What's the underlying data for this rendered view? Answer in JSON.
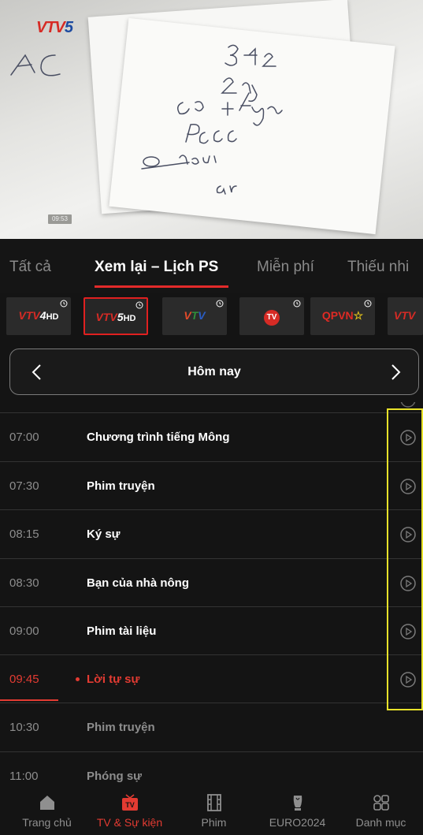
{
  "video": {
    "channel_logo_part1": "VTV",
    "channel_logo_part2": "5",
    "timestamp": "09:53",
    "handwriting_lines": [
      "AC",
      "3+1",
      "2 ng",
      "có + thang",
      "PCCC",
      "Ơ nấu ăn"
    ]
  },
  "tabs": [
    {
      "label": "Tất cả",
      "active": false
    },
    {
      "label": "Xem lại – Lịch PS",
      "active": true
    },
    {
      "label": "Miễn phí",
      "active": false
    },
    {
      "label": "Thiếu nhi",
      "active": false
    }
  ],
  "channels": [
    {
      "name": "VTV4 HD",
      "logo_text": "VTV4HD",
      "selected": false
    },
    {
      "name": "VTV5 HD",
      "logo_text": "VTV5HD",
      "selected": true
    },
    {
      "name": "VTV Cần Thơ",
      "logo_text": "VTV",
      "selected": false
    },
    {
      "name": "TV Quốc Hội",
      "logo_text": "TV",
      "selected": false
    },
    {
      "name": "QPVN",
      "logo_text": "QPVN☆",
      "selected": false
    },
    {
      "name": "VTV",
      "logo_text": "VTV",
      "selected": false
    }
  ],
  "date_selector": {
    "label": "Hôm nay",
    "prev_icon": "chevron-left-icon",
    "next_icon": "chevron-right-icon"
  },
  "schedule": [
    {
      "time": "07:00",
      "title": "Chương trình tiếng Mông",
      "state": "past"
    },
    {
      "time": "07:30",
      "title": "Phim truyện",
      "state": "past"
    },
    {
      "time": "08:15",
      "title": "Ký sự",
      "state": "past"
    },
    {
      "time": "08:30",
      "title": "Bạn của nhà nông",
      "state": "past"
    },
    {
      "time": "09:00",
      "title": "Phim tài liệu",
      "state": "past"
    },
    {
      "time": "09:45",
      "title": "Lời tự sự",
      "state": "live"
    },
    {
      "time": "10:30",
      "title": "Phim truyện",
      "state": "future"
    },
    {
      "time": "11:00",
      "title": "Phóng sự",
      "state": "future"
    }
  ],
  "bottom_nav": [
    {
      "label": "Trang chủ",
      "icon": "home-icon",
      "active": false
    },
    {
      "label": "TV & Sự kiện",
      "icon": "tv-icon",
      "active": true
    },
    {
      "label": "Phim",
      "icon": "film-icon",
      "active": false
    },
    {
      "label": "EURO2024",
      "icon": "trophy-icon",
      "active": false
    },
    {
      "label": "Danh mục",
      "icon": "grid-icon",
      "active": false
    }
  ],
  "colors": {
    "accent": "#e33b32",
    "highlight": "#e8e22a",
    "background": "#141414"
  }
}
